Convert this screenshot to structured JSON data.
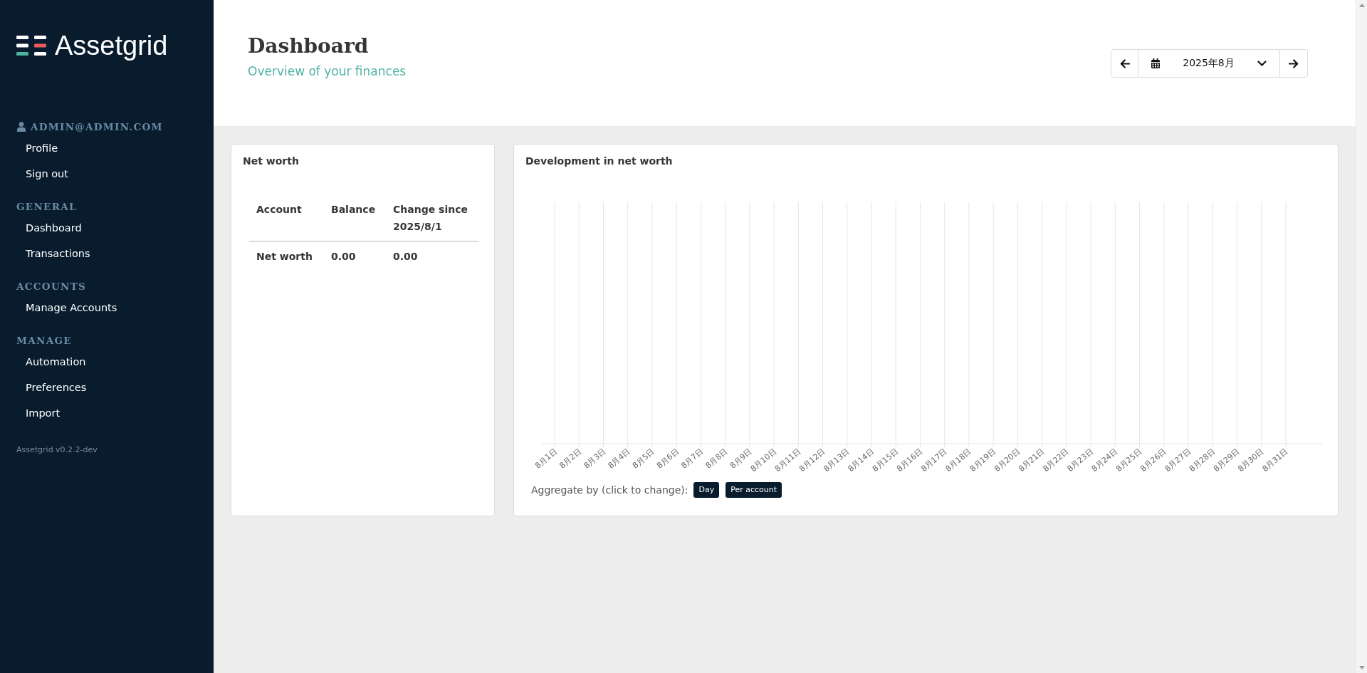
{
  "sidebar": {
    "logo": {
      "text": "Assetgrid"
    },
    "user": {
      "email": "ADMIN@ADMIN.COM",
      "items": [
        "Profile",
        "Sign out"
      ]
    },
    "sections": [
      {
        "heading": "GENERAL",
        "items": [
          "Dashboard",
          "Transactions"
        ]
      },
      {
        "heading": "ACCOUNTS",
        "items": [
          "Manage Accounts"
        ]
      },
      {
        "heading": "MANAGE",
        "items": [
          "Automation",
          "Preferences",
          "Import"
        ]
      }
    ],
    "version": "Assetgrid v0.2.2-dev"
  },
  "header": {
    "title": "Dashboard",
    "subtitle": "Overview of your finances",
    "period_picker": {
      "value": "2025年8月"
    }
  },
  "net_worth": {
    "title": "Net worth",
    "table": {
      "columns": [
        "Account",
        "Balance",
        "Change since 2025/8/1"
      ],
      "rows": [
        [
          "Net worth",
          "0.00",
          "0.00"
        ]
      ]
    }
  },
  "development": {
    "title": "Development in net worth",
    "x_axis_labels": [
      "8月1日",
      "8月2日",
      "8月3日",
      "8月4日",
      "8月5日",
      "8月6日",
      "8月7日",
      "8月8日",
      "8月9日",
      "8月10日",
      "8月11日",
      "8月12日",
      "8月13日",
      "8月14日",
      "8月15日",
      "8月16日",
      "8月17日",
      "8月18日",
      "8月19日",
      "8月20日",
      "8月21日",
      "8月22日",
      "8月23日",
      "8月24日",
      "8月25日",
      "8月26日",
      "8月27日",
      "8月28日",
      "8月29日",
      "8月30日",
      "8月31日"
    ],
    "aggregate": {
      "label": "Aggregate by (click to change):",
      "buttons": [
        "Day",
        "Per account"
      ]
    }
  }
}
